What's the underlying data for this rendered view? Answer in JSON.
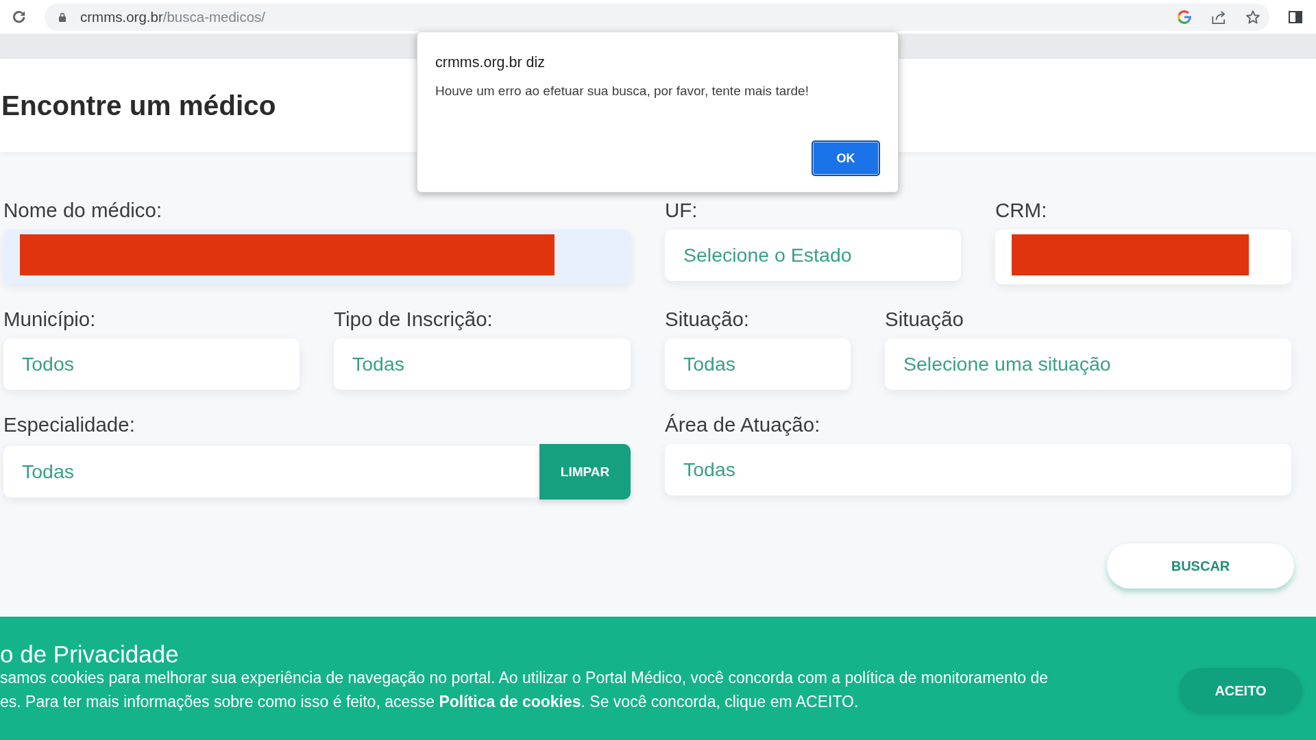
{
  "browser": {
    "url_host": "crmms.org.br",
    "url_path": "/busca-medicos/"
  },
  "page": {
    "title": "Encontre um médico"
  },
  "form": {
    "fields": [
      {
        "label": "Nome do médico:",
        "kind": "text",
        "redacted": true,
        "autofilled": true
      },
      {
        "label": "UF:",
        "kind": "select",
        "value": "Selecione o Estado"
      },
      {
        "label": "CRM:",
        "kind": "text",
        "redacted": true,
        "autofilled": false
      },
      {
        "label": "Município:",
        "kind": "select",
        "value": "Todos"
      },
      {
        "label": "Tipo de Inscrição:",
        "kind": "select",
        "value": "Todas"
      },
      {
        "label": "Situação:",
        "kind": "select",
        "value": "Todas"
      },
      {
        "label": "Situação",
        "kind": "select",
        "value": "Selecione uma situação"
      },
      {
        "label": "Especialidade:",
        "kind": "select",
        "value": "Todas",
        "button": "LIMPAR"
      },
      {
        "label": "Área de Atuação:",
        "kind": "select",
        "value": "Todas"
      }
    ],
    "submit": "BUSCAR"
  },
  "cookie_banner": {
    "title": "o de Privacidade",
    "lines": [
      {
        "text": "samos cookies para melhorar sua experiência de navegação no portal. Ao utilizar o Portal Médico, você concorda com a política de monitoramento de"
      },
      {
        "text": "es. Para ter mais informações sobre como isso é feito, acesse",
        "link": "Política de cookies",
        "after": ". Se você concorda, clique em ACEITO."
      }
    ],
    "button": "ACEITO"
  },
  "dialog": {
    "title": "crmms.org.br diz",
    "message": "Houve um erro ao efetuar sua busca, por favor, tente mais tarde!",
    "button": "OK"
  }
}
